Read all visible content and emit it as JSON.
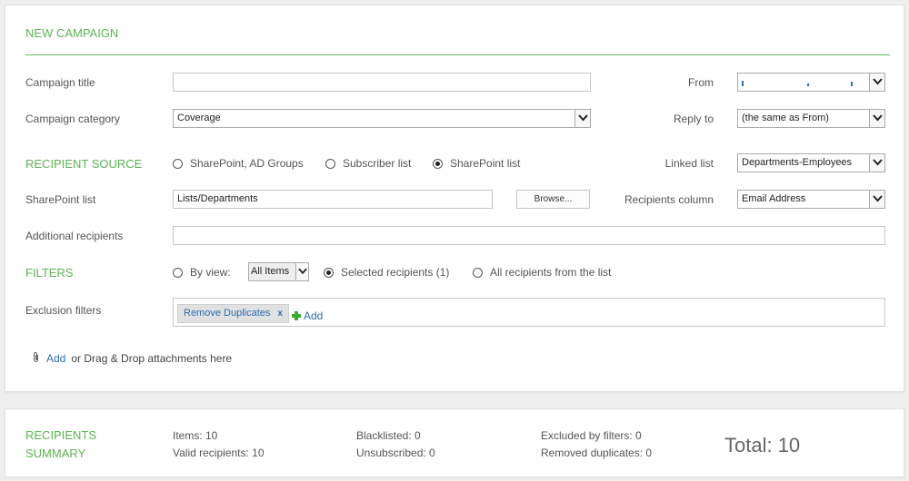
{
  "campaign": {
    "title": "NEW CAMPAIGN",
    "campaign_title_label": "Campaign title",
    "campaign_title_value": "",
    "campaign_category_label": "Campaign category",
    "campaign_category_value": "Coverage",
    "from_label": "From",
    "from_value": "",
    "reply_to_label": "Reply to",
    "reply_to_value": "(the same as From)"
  },
  "recipient_source": {
    "title": "RECIPIENT SOURCE",
    "options": [
      "SharePoint, AD Groups",
      "Subscriber list",
      "SharePoint list"
    ],
    "selected_index": 2,
    "linked_list_label": "Linked list",
    "linked_list_value": "Departments-Employees",
    "sharepoint_list_label": "SharePoint list",
    "sharepoint_list_value": "Lists/Departments",
    "browse_label": "Browse...",
    "recipients_column_label": "Recipients column",
    "recipients_column_value": "Email Address",
    "additional_recipients_label": "Additional recipients",
    "additional_recipients_value": ""
  },
  "filters": {
    "title": "FILTERS",
    "by_view_label": "By view:",
    "view_value": "All Items",
    "selected_recipients_label": "Selected recipients (1)",
    "all_recipients_label": "All recipients from the list",
    "selected_index": 1,
    "exclusion_label": "Exclusion filters",
    "exclusion_tags": [
      "Remove Duplicates"
    ],
    "tag_remove_glyph": "x",
    "add_label": "Add"
  },
  "attachments": {
    "add_label": "Add",
    "hint": "or Drag & Drop attachments here"
  },
  "summary": {
    "title_line1": "RECIPIENTS",
    "title_line2": "SUMMARY",
    "items": "Items: 10",
    "valid": "Valid recipients: 10",
    "blacklisted": "Blacklisted: 0",
    "unsubscribed": "Unsubscribed: 0",
    "excluded": "Excluded by filters: 0",
    "removed_duplicates": "Removed duplicates: 0",
    "total": "Total: 10"
  },
  "colors": {
    "accent_green": "#5bb451",
    "link_blue": "#2a6fb0",
    "background": "#efefef"
  }
}
